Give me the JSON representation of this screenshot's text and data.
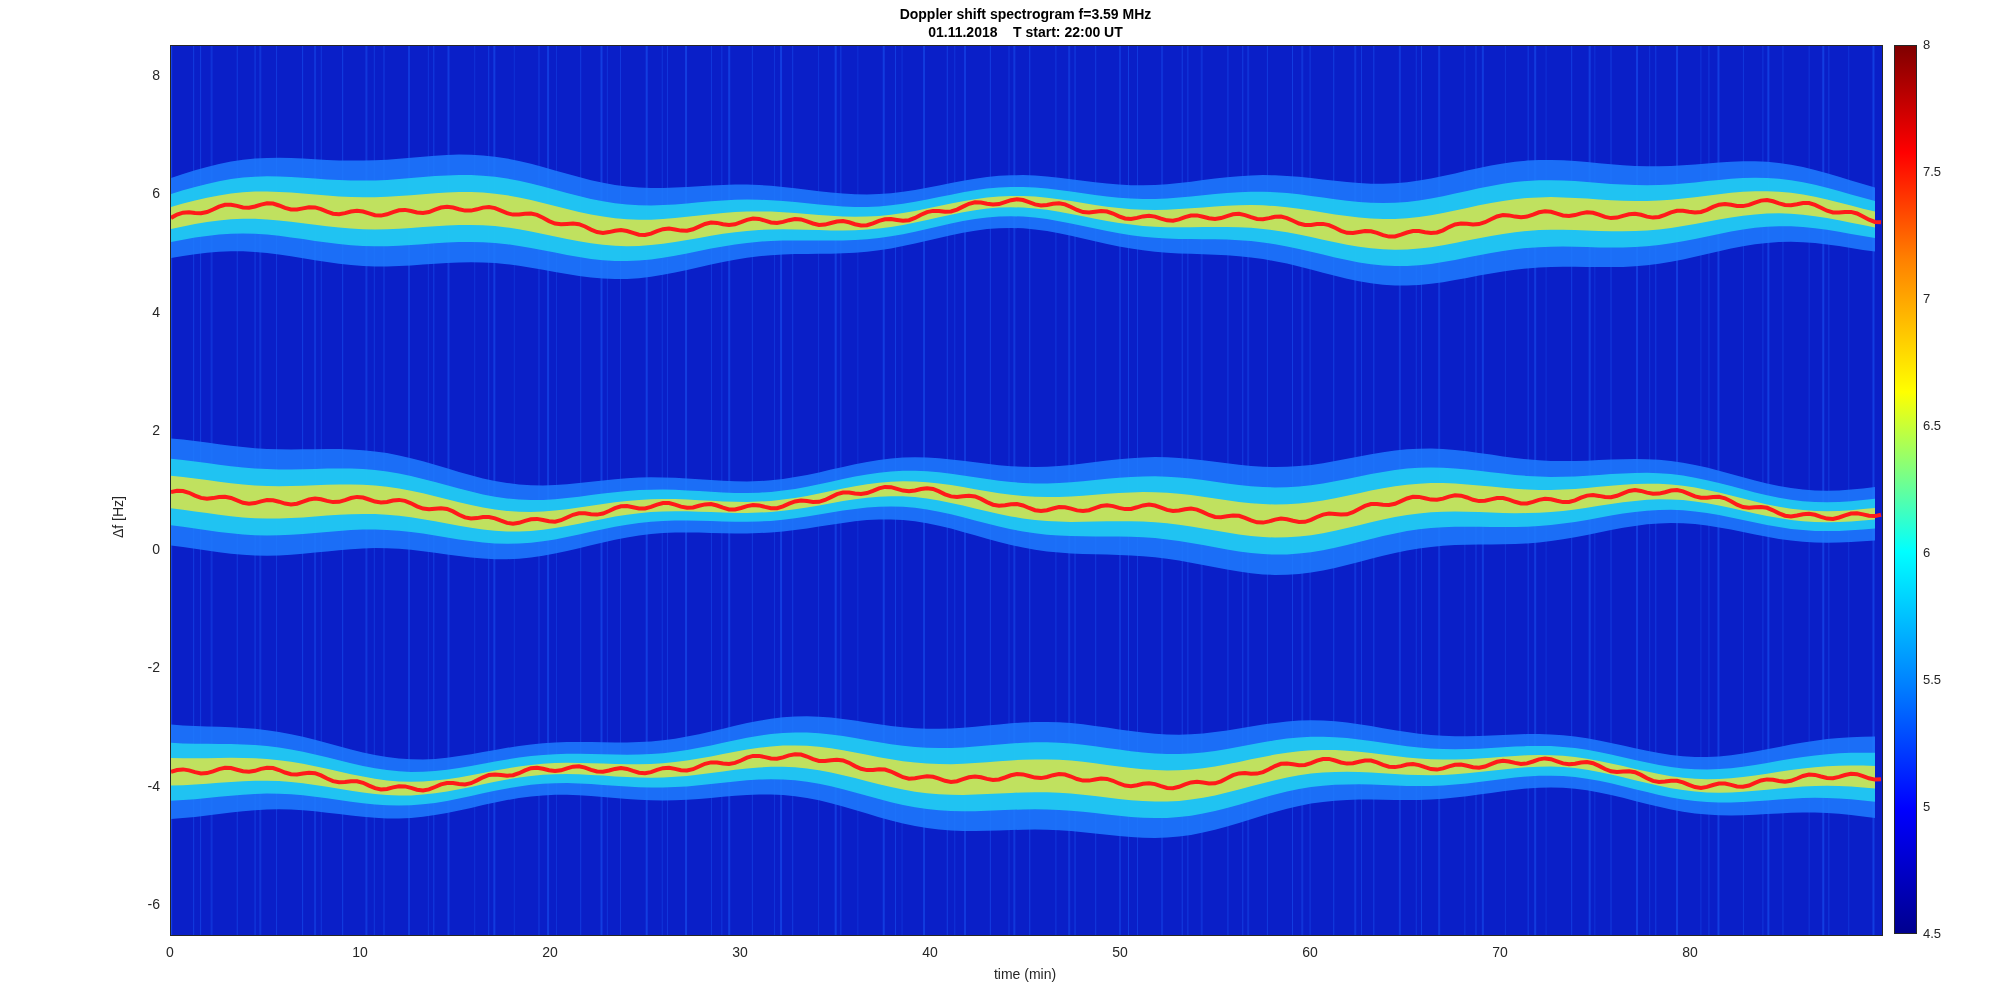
{
  "title": {
    "line_1": "Doppler shift spectrogram f=3.59 MHz",
    "line_2": "01.11.2018    T start: 22:00 UT"
  },
  "plot": {
    "ylabel": "Δf [Hz]",
    "xlabel": "time (min)",
    "yticks": [
      "8",
      "6",
      "4",
      "2",
      "0",
      "-2",
      "-4",
      "-6"
    ],
    "xticks": [
      "0",
      "10",
      "20",
      "30",
      "40",
      "50",
      "60",
      "70",
      "80"
    ]
  },
  "colorbar": {
    "ticks": [
      "8",
      "7.5",
      "7",
      "6.5",
      "6",
      "5.5",
      "5",
      "4.5"
    ]
  }
}
